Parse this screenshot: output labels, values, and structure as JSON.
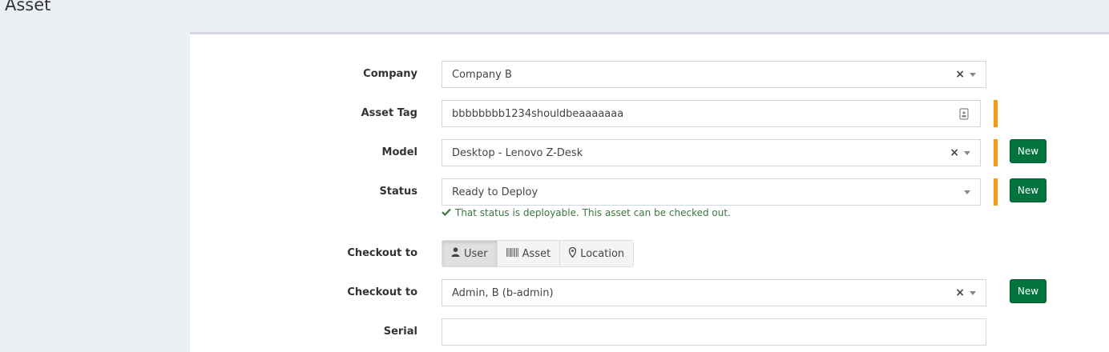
{
  "page": {
    "title": "Asset"
  },
  "form": {
    "company": {
      "label": "Company",
      "value": "Company B"
    },
    "asset_tag": {
      "label": "Asset Tag",
      "value": "bbbbbbbb1234shouldbeaaaaaaa"
    },
    "model": {
      "label": "Model",
      "value": "Desktop - Lenovo Z-Desk",
      "new_label": "New"
    },
    "status": {
      "label": "Status",
      "value": "Ready to Deploy",
      "new_label": "New",
      "help": "That status is deployable. This asset can be checked out."
    },
    "checkout_type": {
      "label": "Checkout to",
      "options": [
        "User",
        "Asset",
        "Location"
      ],
      "selected": "User"
    },
    "checkout_user": {
      "label": "Checkout to",
      "value": "Admin, B (b-admin)",
      "new_label": "New"
    },
    "serial": {
      "label": "Serial",
      "value": ""
    }
  },
  "colors": {
    "required_bar": "#f39c12",
    "new_button": "#00733e",
    "help_text": "#3c763d"
  }
}
